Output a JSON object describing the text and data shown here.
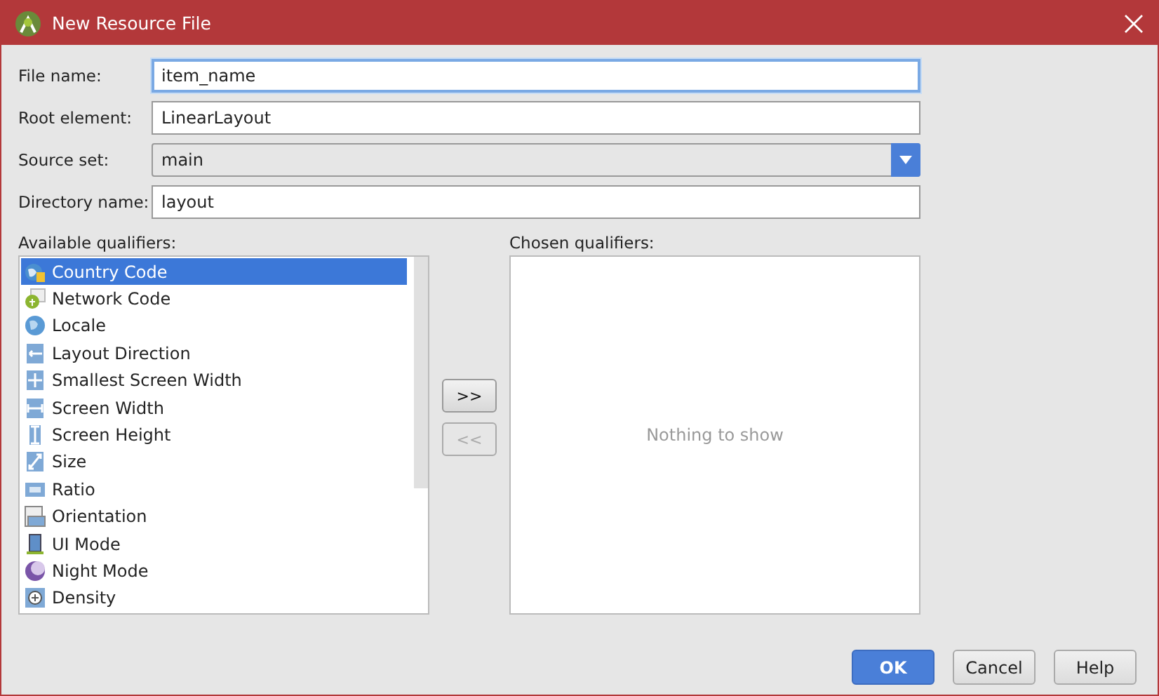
{
  "window": {
    "title": "New Resource File"
  },
  "fields": [
    {
      "kind": "text",
      "label": "File name:",
      "value": "item_name",
      "focused": true
    },
    {
      "kind": "text",
      "label": "Root element:",
      "value": "LinearLayout",
      "focused": false
    },
    {
      "kind": "dropdown",
      "label": "Source set:",
      "value": "main"
    },
    {
      "kind": "text",
      "label": "Directory name:",
      "value": "layout",
      "focused": false
    }
  ],
  "available_qualifiers": {
    "label": "Available qualifiers:",
    "items": [
      {
        "label": "Country Code",
        "selected": true
      },
      {
        "label": "Network Code",
        "selected": false
      },
      {
        "label": "Locale",
        "selected": false
      },
      {
        "label": "Layout Direction",
        "selected": false
      },
      {
        "label": "Smallest Screen Width",
        "selected": false
      },
      {
        "label": "Screen Width",
        "selected": false
      },
      {
        "label": "Screen Height",
        "selected": false
      },
      {
        "label": "Size",
        "selected": false
      },
      {
        "label": "Ratio",
        "selected": false
      },
      {
        "label": "Orientation",
        "selected": false
      },
      {
        "label": "UI Mode",
        "selected": false
      },
      {
        "label": "Night Mode",
        "selected": false
      },
      {
        "label": "Density",
        "selected": false
      }
    ]
  },
  "move_buttons": [
    {
      "label": ">>",
      "disabled": false
    },
    {
      "label": "<<",
      "disabled": true
    }
  ],
  "chosen_qualifiers": {
    "label": "Chosen qualifiers:",
    "empty_text": "Nothing to show"
  },
  "buttons": [
    {
      "label": "OK",
      "default": true
    },
    {
      "label": "Cancel",
      "default": false
    },
    {
      "label": "Help",
      "default": false
    }
  ]
}
